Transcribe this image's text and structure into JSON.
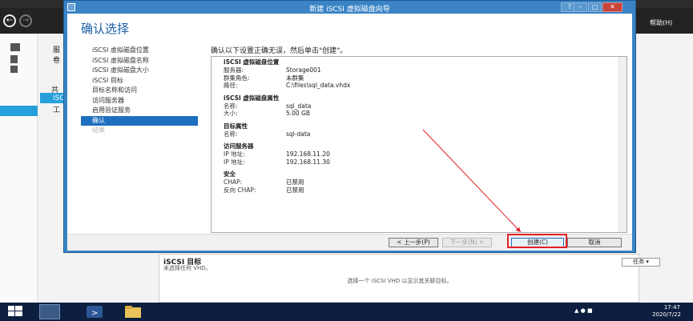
{
  "background": {
    "help_label": "帮助(H)",
    "tree_items": [
      "服",
      "卷",
      "共",
      "iSC",
      "工"
    ],
    "targets_panel": {
      "title": "iSCSI 目标",
      "subtitle": "未选择任何 VHD。",
      "tasks_label": "任务",
      "empty_message": "选择一个 iSCSI VHD 以显示其关联目标。"
    }
  },
  "dialog": {
    "title": "新建 iSCSI 虚拟磁盘向导",
    "heading": "确认选择",
    "instruction": "确认以下设置正确无误，然后单击\"创建\"。",
    "steps": [
      {
        "label": "iSCSI 虚拟磁盘位置",
        "state": "normal"
      },
      {
        "label": "iSCSI 虚拟磁盘名称",
        "state": "normal"
      },
      {
        "label": "iSCSI 虚拟磁盘大小",
        "state": "normal"
      },
      {
        "label": "iSCSI 目标",
        "state": "normal"
      },
      {
        "label": "目标名称和访问",
        "state": "normal"
      },
      {
        "label": "访问服务器",
        "state": "normal"
      },
      {
        "label": "启用验证服务",
        "state": "normal"
      },
      {
        "label": "确认",
        "state": "active"
      },
      {
        "label": "结果",
        "state": "disabled"
      }
    ],
    "summary": {
      "location": {
        "title": "iSCSI 虚拟磁盘位置",
        "rows": [
          {
            "k": "服务器:",
            "v": "Storage001"
          },
          {
            "k": "群集角色:",
            "v": "未群集"
          },
          {
            "k": "路径:",
            "v": "C:\\files\\sql_data.vhdx"
          }
        ]
      },
      "disk": {
        "title": "iSCSI 虚拟磁盘属性",
        "rows": [
          {
            "k": "名称:",
            "v": "sql_data"
          },
          {
            "k": "大小:",
            "v": "5.00 GB"
          }
        ]
      },
      "target": {
        "title": "目标属性",
        "rows": [
          {
            "k": "名称:",
            "v": "sql-data"
          }
        ]
      },
      "access": {
        "title": "访问服务器",
        "rows": [
          {
            "k": "IP 地址:",
            "v": "192.168.11.20"
          },
          {
            "k": "IP 地址:",
            "v": "192.168.11.30"
          }
        ]
      },
      "security": {
        "title": "安全",
        "rows": [
          {
            "k": "CHAP:",
            "v": "已禁用"
          },
          {
            "k": "反向 CHAP:",
            "v": "已禁用"
          }
        ]
      }
    },
    "buttons": {
      "previous": "< 上一步(P)",
      "next": "下一步(N) >",
      "create": "创建(C)",
      "cancel": "取消"
    }
  },
  "taskbar": {
    "time": "17:47",
    "date": "2020/7/22"
  },
  "colors": {
    "dialog_frame": "#3a84c6",
    "heading": "#1a5da6",
    "active_step": "#1f6fbf",
    "annotation": "#e21f26",
    "taskbar": "#0d1f40"
  }
}
